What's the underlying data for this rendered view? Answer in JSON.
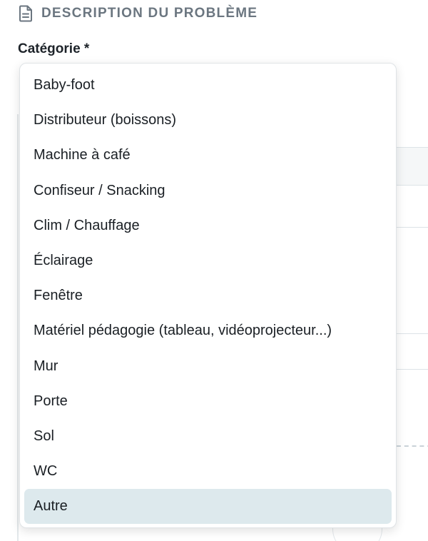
{
  "section": {
    "title": "DESCRIPTION DU PROBLÈME",
    "icon": "document-icon"
  },
  "field": {
    "label": "Catégorie *"
  },
  "dropdown": {
    "options": [
      "Baby-foot",
      "Distributeur (boissons)",
      "Machine à café",
      "Confiseur / Snacking",
      "Clim / Chauffage",
      "Éclairage",
      "Fenêtre",
      "Matériel pédagogie (tableau, vidéoprojecteur...)",
      "Mur",
      "Porte",
      "Sol",
      "WC",
      "Autre"
    ],
    "highlighted": "Autre"
  },
  "colors": {
    "highlight": "#dde9ed",
    "section_title": "#6b7680",
    "text": "#1a1f24"
  }
}
